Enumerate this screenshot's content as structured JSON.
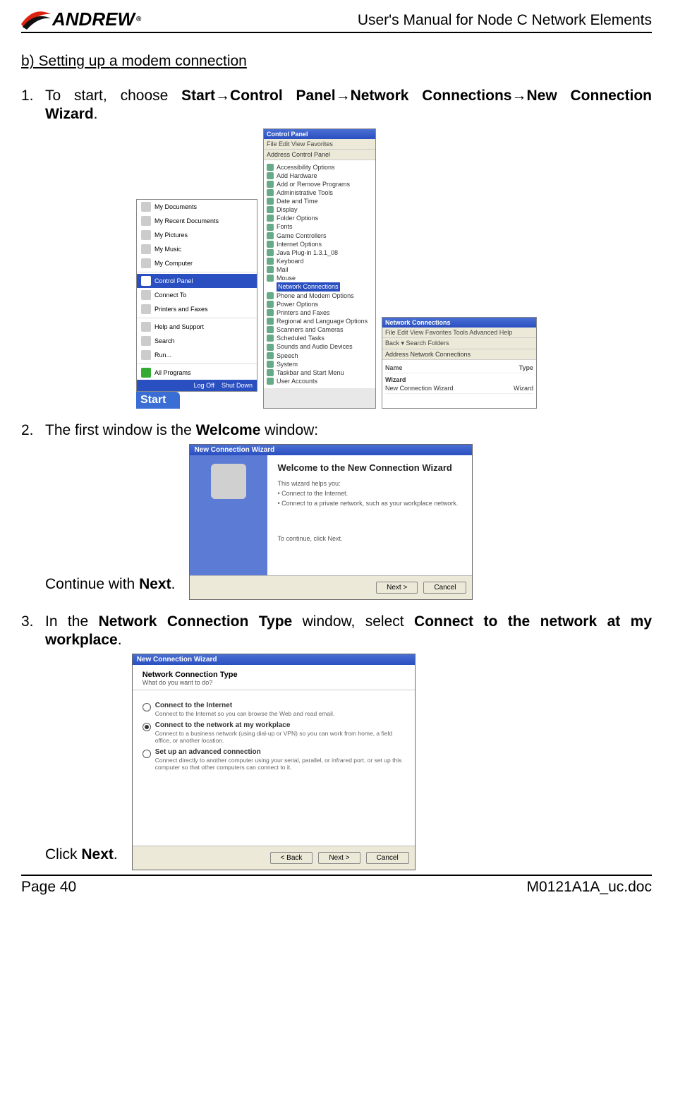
{
  "header": {
    "logo_text": "ANDREW",
    "logo_reg": "®",
    "doc_title": "User's Manual for Node C Network Elements"
  },
  "section": {
    "heading": "b) Setting up a modem connection"
  },
  "steps": {
    "s1_num": "1.",
    "s1_pre": "To start, choose ",
    "s1_b1": "Start",
    "s1_arr": "→",
    "s1_b2": "Control Panel",
    "s1_b3": "Network Connections",
    "s1_b4": "New Connection Wizard",
    "s1_dot": ".",
    "s2_num": "2.",
    "s2_pre": "The first window is the ",
    "s2_b": "Welcome",
    "s2_post": " window:",
    "s2_cont_pre": "Continue with ",
    "s2_cont_b": "Next",
    "s2_cont_post": ".",
    "s3_num": "3.",
    "s3_pre": "In the ",
    "s3_b1": "Network Connection Type",
    "s3_mid": " window, select ",
    "s3_b2": "Connect to the network at my workplace",
    "s3_post": ".",
    "s3_click_pre": "Click ",
    "s3_click_b": "Next",
    "s3_click_post": "."
  },
  "start_menu": {
    "items": [
      "My Documents",
      "My Recent Documents",
      "My Pictures",
      "My Music",
      "My Computer"
    ],
    "cp": "Control Panel",
    "below": [
      "Connect To",
      "Printers and Faxes",
      "Help and Support",
      "Search",
      "Run..."
    ],
    "all": "All Programs",
    "logoff": "Log Off",
    "shutdown": "Shut Down",
    "start": "Start"
  },
  "control_panel": {
    "title": "Control Panel",
    "menu": "File  Edit  View  Favorites",
    "addr": "Address  Control Panel",
    "items": [
      "Accessibility Options",
      "Add Hardware",
      "Add or Remove Programs",
      "Administrative Tools",
      "Date and Time",
      "Display",
      "Folder Options",
      "Fonts",
      "Game Controllers",
      "Internet Options",
      "Java Plug-in 1.3.1_08",
      "Keyboard",
      "Mail",
      "Mouse"
    ],
    "highlight": "Network Connections",
    "items2": [
      "Phone and Modem Options",
      "Power Options",
      "Printers and Faxes",
      "Regional and Language Options",
      "Scanners and Cameras",
      "Scheduled Tasks",
      "Sounds and Audio Devices",
      "Speech",
      "System",
      "Taskbar and Start Menu",
      "User Accounts"
    ]
  },
  "nc_window": {
    "title": "Network Connections",
    "menu": "File  Edit  View  Favorites  Tools  Advanced  Help",
    "toolbar": "Back  ▾    Search   Folders",
    "addr": "Address  Network Connections",
    "col1": "Name",
    "col2": "Type",
    "group": "Wizard",
    "item": "New Connection Wizard",
    "itemtype": "Wizard"
  },
  "wizard1": {
    "title": "New Connection Wizard",
    "heading": "Welcome to the New Connection Wizard",
    "p1": "This wizard helps you:",
    "b1": "Connect to the Internet.",
    "b2": "Connect to a private network, such as your workplace network.",
    "cont": "To continue, click Next.",
    "btn_next": "Next >",
    "btn_cancel": "Cancel"
  },
  "wizard2": {
    "title": "New Connection Wizard",
    "h": "Network Connection Type",
    "sub": "What do you want to do?",
    "o1": "Connect to the Internet",
    "o1d": "Connect to the Internet so you can browse the Web and read email.",
    "o2": "Connect to the network at my workplace",
    "o2d": "Connect to a business network (using dial-up or VPN) so you can work from home, a field office, or another location.",
    "o3": "Set up an advanced connection",
    "o3d": "Connect directly to another computer using your serial, parallel, or infrared port, or set up this computer so that other computers can connect to it.",
    "btn_back": "< Back",
    "btn_next": "Next >",
    "btn_cancel": "Cancel"
  },
  "footer": {
    "left": "Page 40",
    "right": "M0121A1A_uc.doc"
  }
}
